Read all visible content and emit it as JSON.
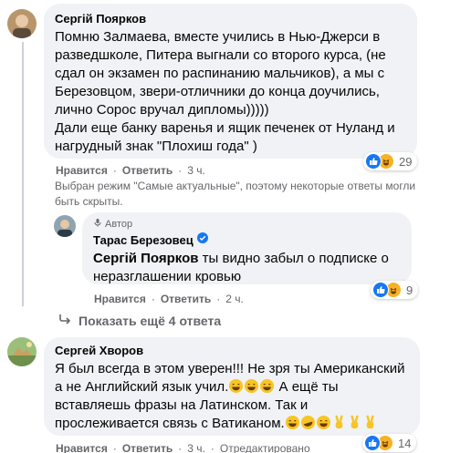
{
  "comments": [
    {
      "author": "Сергій Поярков",
      "text": "Помню Залмаева, вместе учились в Нью-Джерси в\nразведшколе, Питера выгнали со второго курса, (не\nсдал он экзамен по распинанию мальчиков), а мы с\nБерезовцом, звери-отличники до конца доучились,\nлично Сорос вручал дипломы)))))\nДали еще банку варенья и ящик печенек от Нуланд и\nнагрудный знак \"Плохиш года\" )",
      "like_label": "Нравится",
      "reply_label": "Ответить",
      "time": "3 ч.",
      "reaction_count": "29"
    },
    {
      "author_badge": "Автор",
      "author": "Тарас Березовец",
      "mention": "Сергій Поярков",
      "text": " ты видно забыл о подписке о\nнеразглашении кровью",
      "like_label": "Нравится",
      "reply_label": "Ответить",
      "time": "2 ч.",
      "reaction_count": "9"
    },
    {
      "author": "Сергей Хворов",
      "text_line1": "Я был всегда в этом уверен!!! Не зря ты Американский",
      "text_line2": "а не Английский язык учил.",
      "text_line3": " А ещё ты",
      "text_line4": "вставляешь фразы на Латинском. Так и",
      "text_line5": "прослеживается связь с Ватиканом.",
      "like_label": "Нравится",
      "reply_label": "Ответить",
      "time": "3 ч.",
      "extra": "Отредактировано",
      "reaction_count": "14"
    }
  ],
  "notice": "Выбран режим \"Самые актуальные\", поэтому некоторые ответы могли быть скрыты.",
  "more_replies": "Показать ещё 4 ответа",
  "colors": {
    "bubble": "#f0f2f5",
    "meta": "#65676b",
    "like": "#1877f2",
    "haha": "#f7b125"
  },
  "icons": [
    "like-icon",
    "haha-icon",
    "verified-badge-icon",
    "reply-arrow-icon",
    "author-mic-icon"
  ]
}
